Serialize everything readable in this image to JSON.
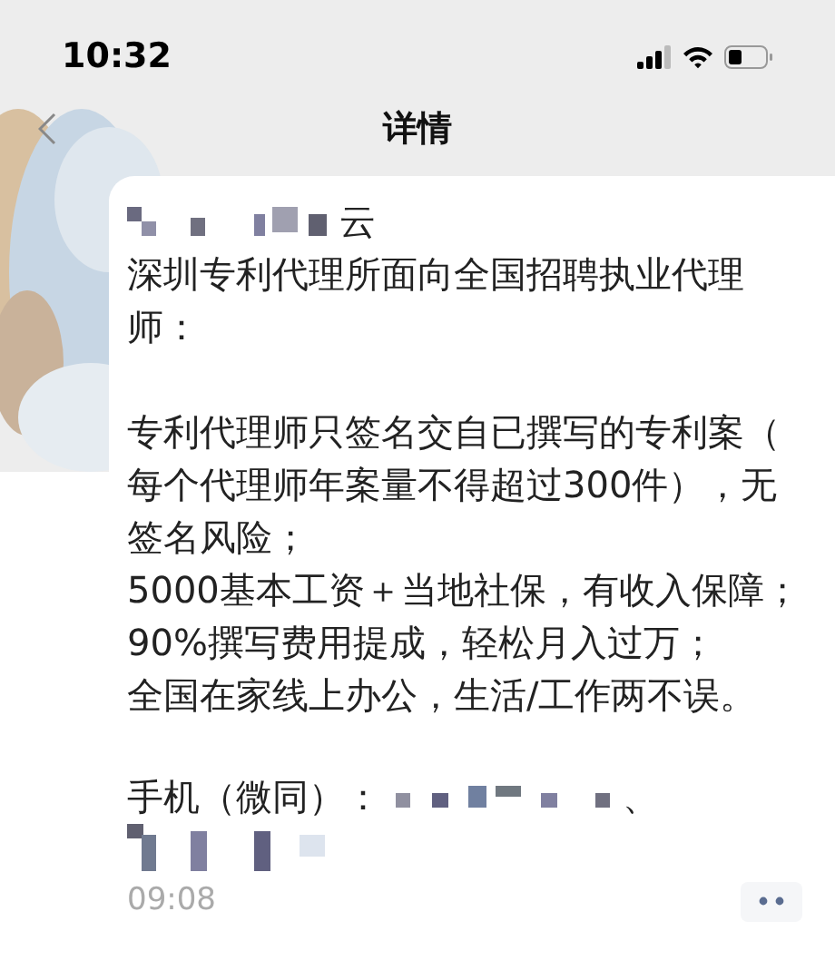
{
  "status_bar": {
    "time": "10:32"
  },
  "nav": {
    "title": "详情"
  },
  "post": {
    "author_visible": "云",
    "paragraphs": [
      [
        "深圳专利代理所面向全国招聘执业代理",
        "师："
      ],
      [
        "专利代理师只签名交自已撰写的专利案（",
        "每个代理师年案量不得超过300件），无",
        "签名风险；",
        "5000基本工资＋当地社保，有收入保障；",
        "90%撰写费用提成，轻松月入过万；",
        "全国在家线上办公，生活/工作两不误。"
      ]
    ],
    "contact_label": "手机（微同）：",
    "contact_sep": "、",
    "time": "09:08"
  }
}
